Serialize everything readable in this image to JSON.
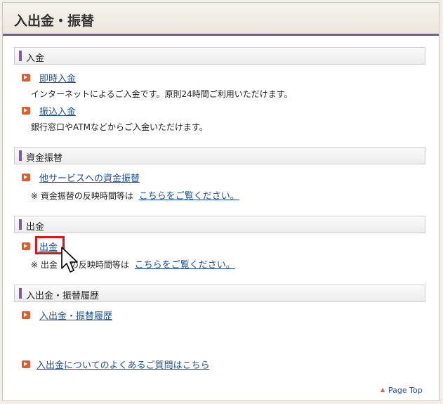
{
  "header": {
    "title": "入出金・振替"
  },
  "sections": {
    "deposit": {
      "title": "入金",
      "items": [
        {
          "link": "即時入金",
          "desc": "インターネットによるご入金です。原則24時間ご利用いただけます。"
        },
        {
          "link": "振込入金",
          "desc": "銀行窓口やATMなどからご入金いただけます。"
        }
      ]
    },
    "transfer": {
      "title": "資金振替",
      "link": "他サービスへの資金振替",
      "note_prefix": "※ 資金振替の反映時間等は",
      "note_link": "こちらをご覧ください。"
    },
    "withdrawal": {
      "title": "出金",
      "link": "出金",
      "note_prefix": "※ 出金",
      "note_mid": "の反映時間等は",
      "note_link": "こちらをご覧ください。"
    },
    "history": {
      "title": "入出金・振替履歴",
      "link": "入出金・振替履歴"
    }
  },
  "faq": {
    "link": "入出金についてのよくあるご質問はこちら"
  },
  "footer": {
    "page_top": "Page Top"
  }
}
